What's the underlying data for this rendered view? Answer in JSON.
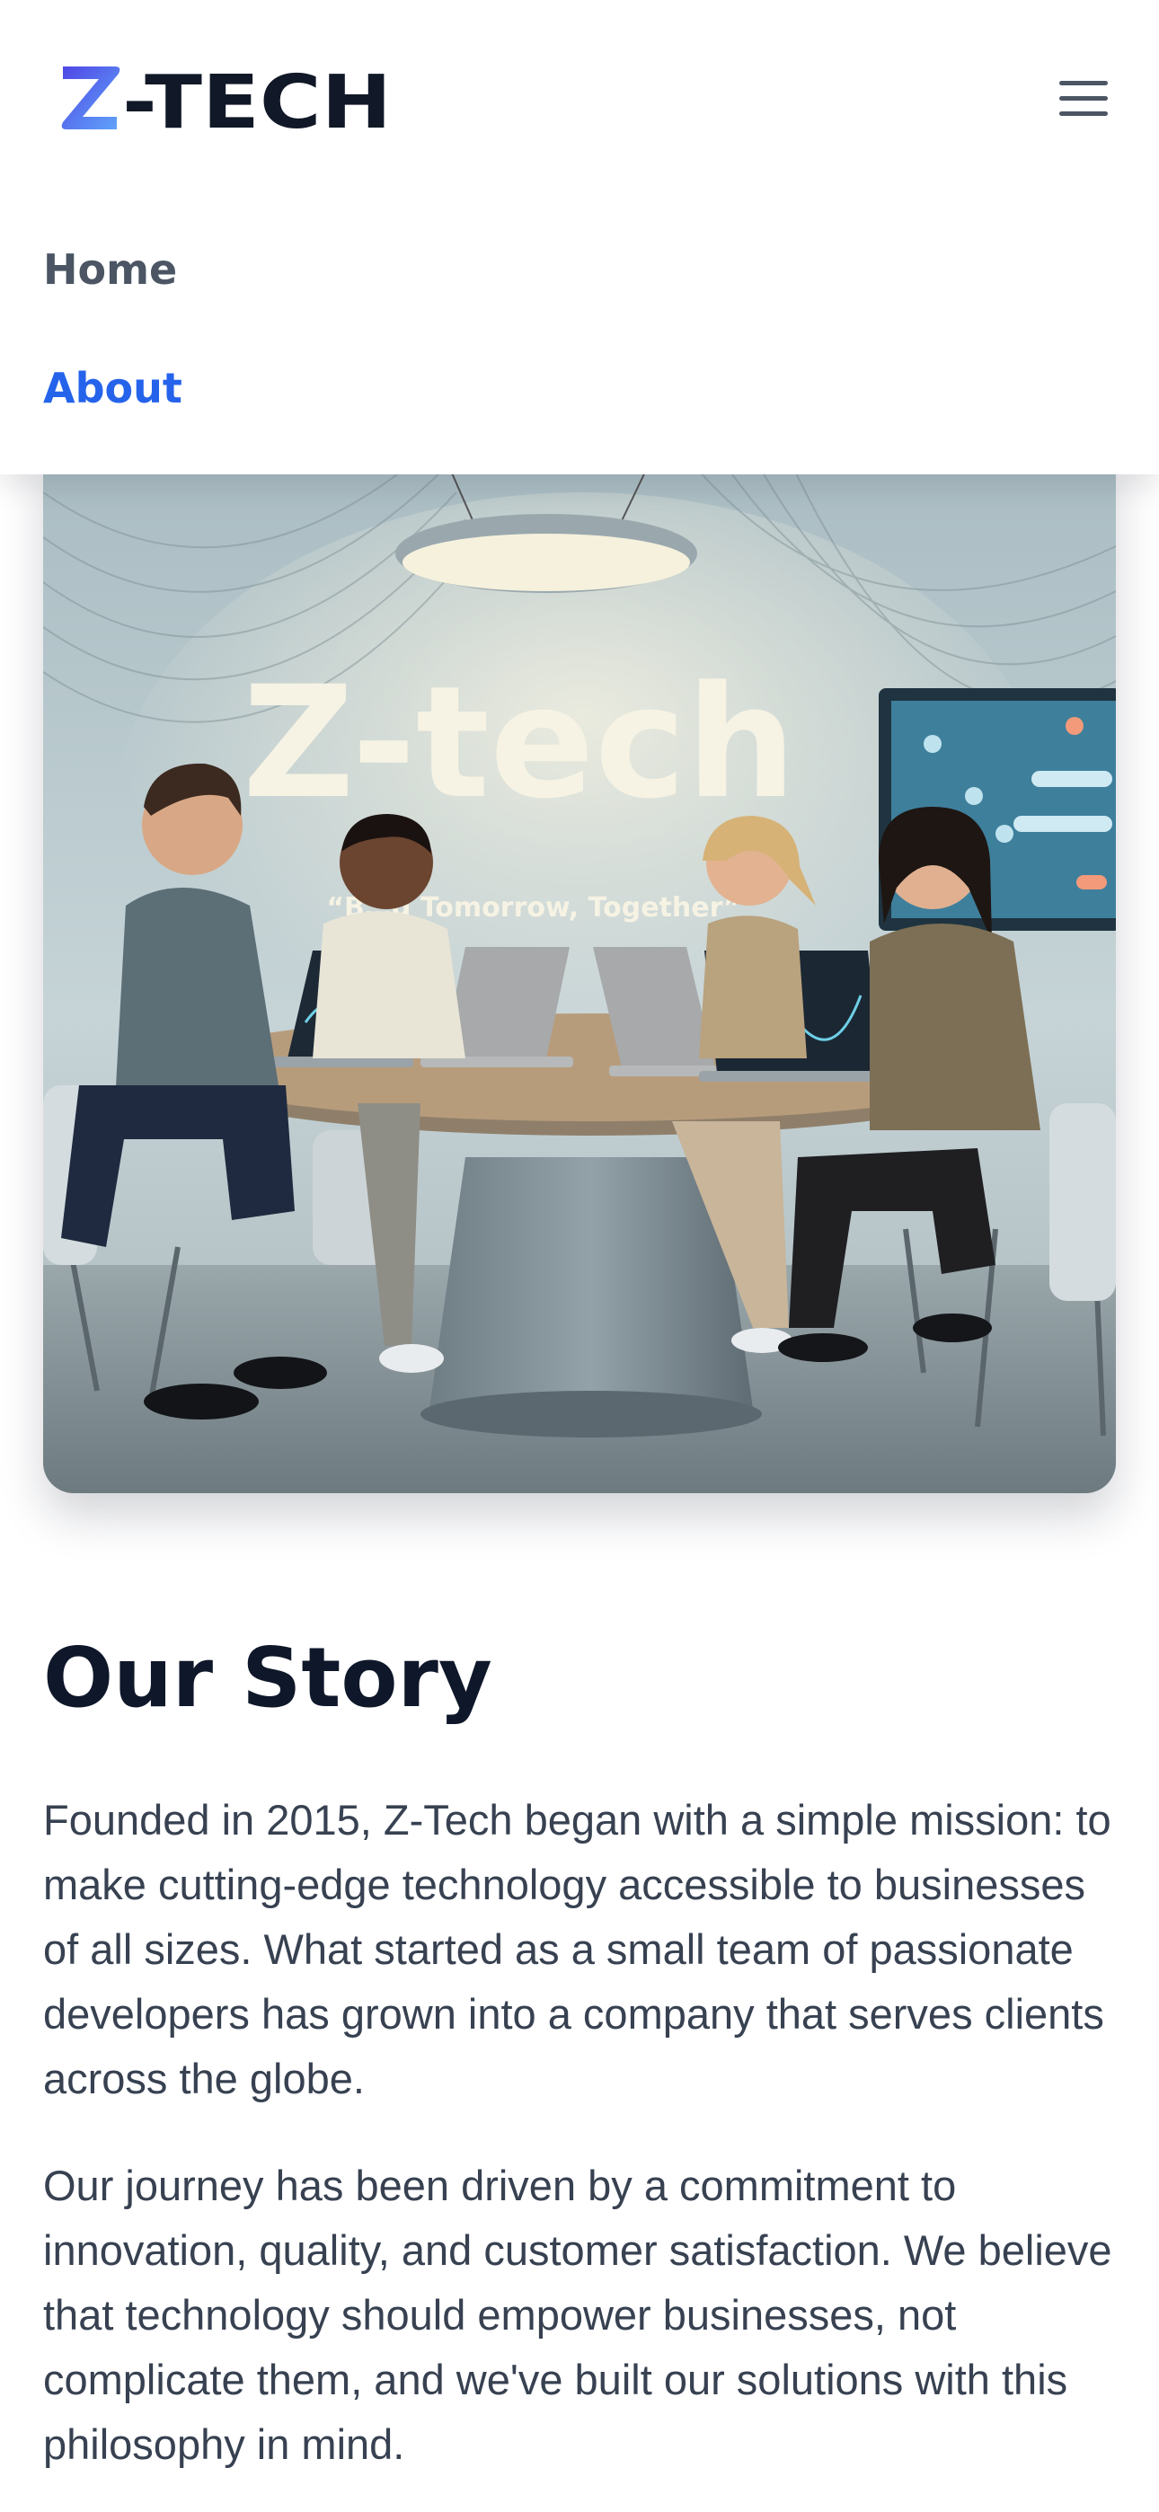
{
  "brand": {
    "logo_text": "Z-TECH",
    "logo_alt": "Z-TECH logo"
  },
  "nav": {
    "items": [
      {
        "label": "Home",
        "active": false
      },
      {
        "label": "About",
        "active": true
      }
    ]
  },
  "hero": {
    "image_alt": "Z-Tech team meeting around a round table with laptops",
    "wall_title": "Z-tech",
    "wall_tagline": "“B…g Tomorrow, Together”"
  },
  "story": {
    "title": "Our Story",
    "paragraphs": [
      "Founded in 2015, Z-Tech began with a simple mission: to make cutting-edge technology accessible to businesses of all sizes. What started as a small team of passionate developers has grown into a company that serves clients across the globe.",
      "Our journey has been driven by a commitment to innovation, quality, and customer satisfaction. We believe that technology should empower businesses, not complicate them, and we've built our solutions with this philosophy in mind."
    ]
  },
  "colors": {
    "accent": "#2563eb",
    "nav_text": "#4b5563",
    "heading": "#0f172a",
    "body_text": "#374151",
    "logo_dark": "#111827",
    "logo_gradient": [
      "#4f46e5",
      "#60a5fa"
    ]
  },
  "icons": {
    "menu": "hamburger-menu-icon"
  }
}
